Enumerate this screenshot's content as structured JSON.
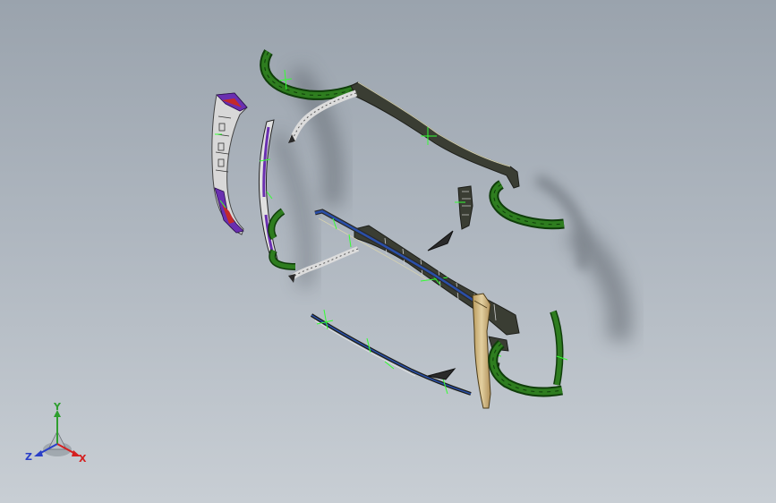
{
  "viewport": {
    "background_top": "#9aa3ad",
    "background_bottom": "#c8ced4"
  },
  "colors": {
    "green_part": "#2e7d1f",
    "green_edge": "#0f3d0a",
    "dark_part": "#3a3d33",
    "tan_part": "#c9b27a",
    "blue_line": "#2a4fa8",
    "purple_part": "#6a2fb0",
    "red_part": "#c42a2a",
    "grey_part": "#cfcfcf",
    "shadow": "#5a6068",
    "axis_x": "#d42020",
    "axis_y": "#2e9e2e",
    "axis_z": "#2a3fc8"
  },
  "parts": [
    "upper-left-green-arc",
    "upper-frame-bar",
    "upper-right-green-arc",
    "left-purple-panel",
    "left-inner-panel",
    "center-small-bracket",
    "center-small-wedge",
    "lower-frame-bar",
    "lower-blue-rail",
    "tan-end-plate",
    "lower-right-green-arc",
    "lower-rail",
    "lower-wedge"
  ],
  "triad": {
    "x_label": "X",
    "y_label": "Y",
    "z_label": "Z"
  }
}
